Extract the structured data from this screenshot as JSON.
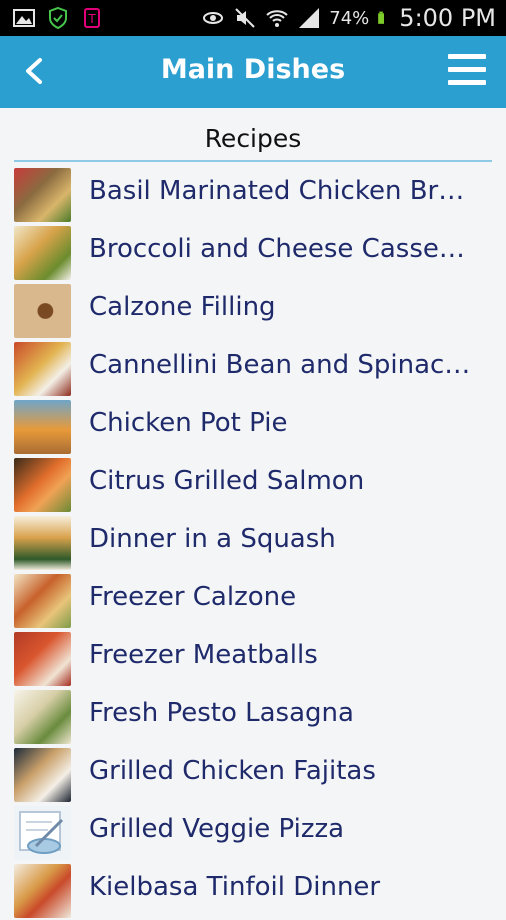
{
  "status_bar": {
    "icons": [
      "image-icon",
      "shield-icon",
      "tmobile-icon",
      "eye-icon",
      "mute-icon",
      "wifi-icon",
      "signal-icon",
      "battery-icon"
    ],
    "battery": "74%",
    "time": "5:00 PM"
  },
  "header": {
    "title": "Main Dishes",
    "back_icon": "chevron-left-icon",
    "menu_icon": "hamburger-menu-icon"
  },
  "section": {
    "title": "Recipes"
  },
  "recipes": [
    {
      "label": "Basil Marinated Chicken Br…"
    },
    {
      "label": "Broccoli and Cheese Casse…"
    },
    {
      "label": "Calzone Filling"
    },
    {
      "label": "Cannellini Bean and Spinac…"
    },
    {
      "label": "Chicken Pot Pie"
    },
    {
      "label": "Citrus Grilled Salmon"
    },
    {
      "label": "Dinner in a Squash"
    },
    {
      "label": "Freezer Calzone"
    },
    {
      "label": "Freezer Meatballs"
    },
    {
      "label": "Fresh Pesto Lasagna"
    },
    {
      "label": "Grilled Chicken Fajitas"
    },
    {
      "label": "Grilled Veggie Pizza"
    },
    {
      "label": "Kielbasa Tinfoil Dinner"
    }
  ],
  "colors": {
    "appbar": "#2b9fd0",
    "text": "#1f2a6b",
    "background": "#f4f5f7"
  }
}
